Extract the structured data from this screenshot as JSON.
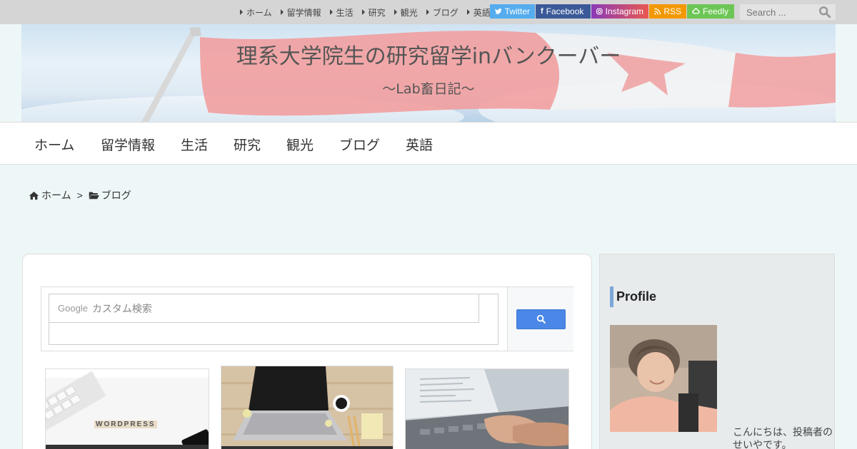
{
  "topbar": {
    "links": [
      "ホーム",
      "留学情報",
      "生活",
      "研究",
      "観光",
      "ブログ",
      "英語"
    ],
    "social": {
      "twitter": "Twitter",
      "facebook": "Facebook",
      "instagram": "Instagram",
      "rss": "RSS",
      "feedly": "Feedly"
    },
    "search_placeholder": "Search ..."
  },
  "header": {
    "title": "理系大学院生の研究留学inバンクーバー",
    "subtitle": "～Lab畜日記～"
  },
  "nav": {
    "items": [
      "ホーム",
      "留学情報",
      "生活",
      "研究",
      "観光",
      "ブログ",
      "英語"
    ]
  },
  "breadcrumb": {
    "home": "ホーム",
    "separator": ">",
    "current": "ブログ"
  },
  "search_widget": {
    "placeholder_brand": "Google",
    "placeholder_text": "カスタム検索"
  },
  "thumbnails": {
    "t1_text": "WORDPRESS"
  },
  "sidebar": {
    "title": "Profile",
    "greeting": "こんにちは、投稿者のせいやです。"
  },
  "colors": {
    "twitter": "#55acee",
    "facebook": "#3b5998",
    "rss": "#f39800",
    "feedly": "#6cc655",
    "google_button": "#4a87e6",
    "sidebar_accent": "#7ea7d8"
  }
}
